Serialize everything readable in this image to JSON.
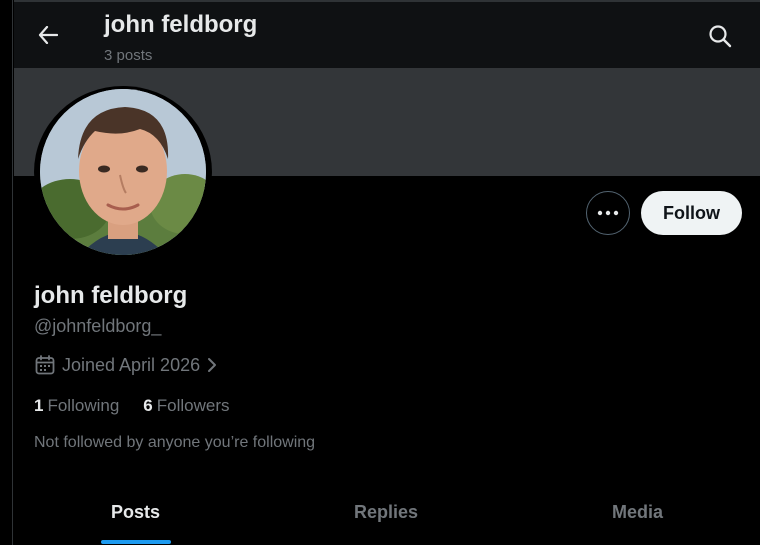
{
  "header": {
    "title": "john feldborg",
    "posts_count": "3 posts"
  },
  "profile": {
    "display_name": "john feldborg",
    "handle": "@johnfeldborg_",
    "joined": "Joined April 2026",
    "following_count": "1",
    "following_label": "Following",
    "followers_count": "6",
    "followers_label": "Followers",
    "not_followed_text": "Not followed by anyone you’re following"
  },
  "actions": {
    "follow_label": "Follow"
  },
  "tabs": [
    {
      "label": "Posts",
      "active": true
    },
    {
      "label": "Replies",
      "active": false
    },
    {
      "label": "Media",
      "active": false
    }
  ],
  "colors": {
    "background": "#000000",
    "banner": "#333639",
    "accent": "#1d9bf0",
    "muted_text": "#71767b",
    "primary_text": "#e7e9ea"
  },
  "icons": {
    "back": "arrow-left-icon",
    "search": "search-icon",
    "more": "more-horizontal-icon",
    "calendar": "calendar-icon",
    "chevron": "chevron-right-icon"
  }
}
